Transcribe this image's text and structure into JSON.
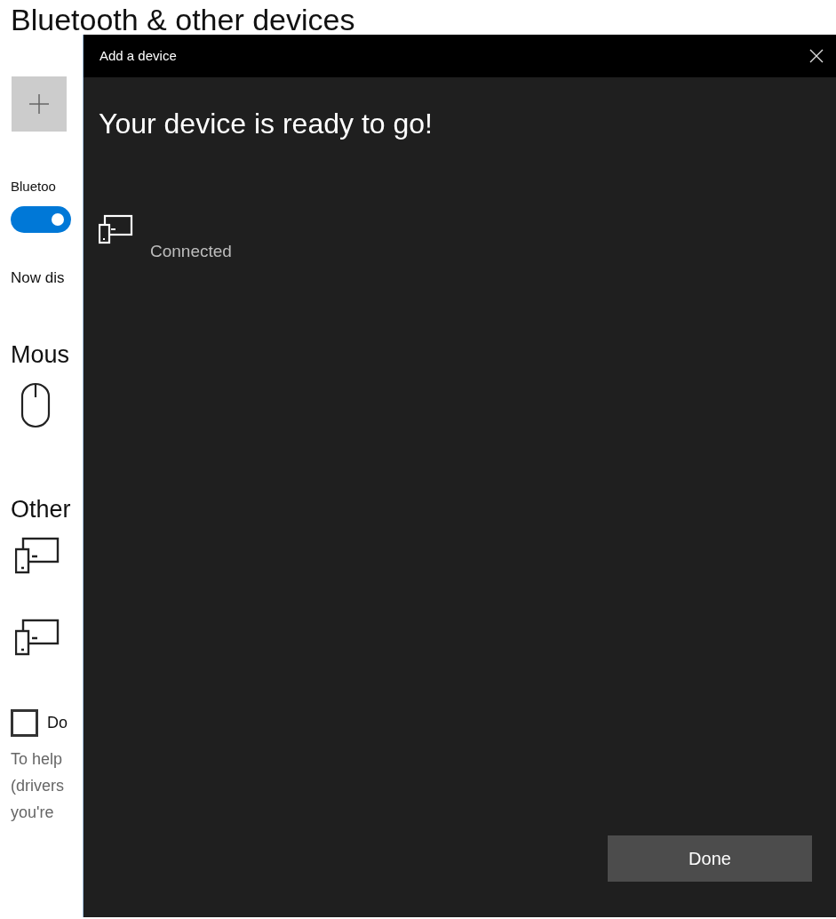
{
  "settings": {
    "title": "Bluetooth & other devices",
    "bluetooth_label": "Bluetoo",
    "bluetooth_on": true,
    "discoverable_text": "Now dis",
    "sections": [
      {
        "heading": "Mous",
        "devices": [
          {
            "kind": "mouse"
          }
        ]
      },
      {
        "heading": "Other",
        "devices": [
          {
            "kind": "device"
          },
          {
            "kind": "device"
          }
        ]
      }
    ],
    "checkbox": {
      "label": "Do",
      "checked": false
    },
    "note_lines": [
      "To help",
      "(drivers",
      "you're"
    ]
  },
  "dialog": {
    "title": "Add a device",
    "heading": "Your device is ready to go!",
    "device_status": "Connected",
    "button": "Done"
  }
}
